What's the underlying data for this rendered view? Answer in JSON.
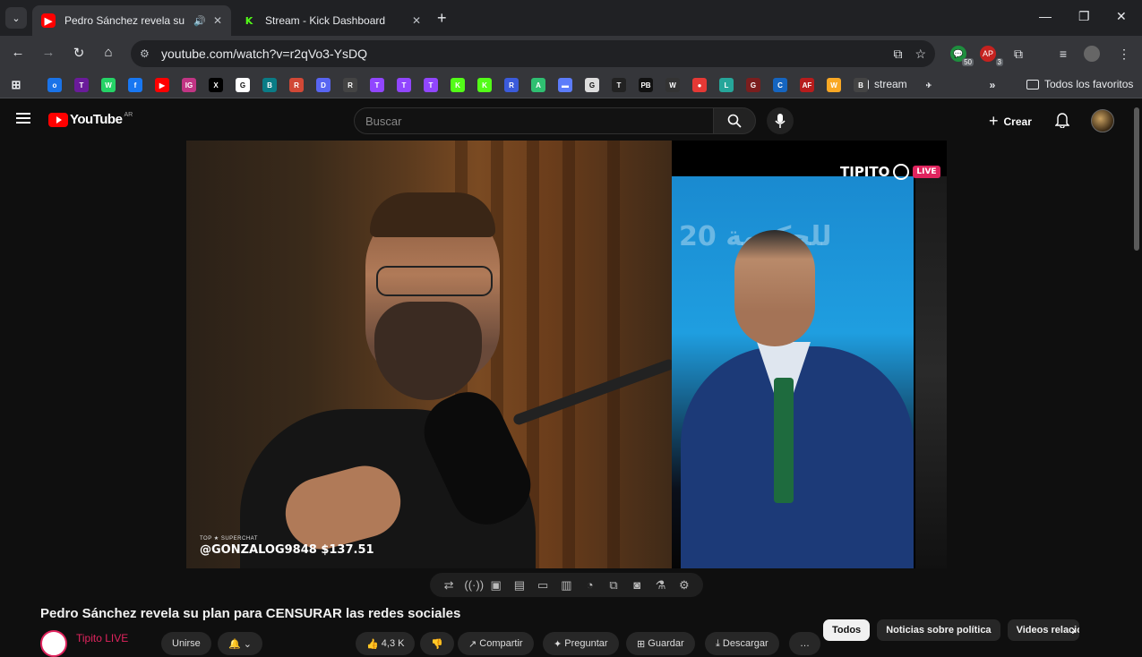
{
  "browser": {
    "tabs": [
      {
        "title": "Pedro Sánchez revela su pla",
        "favicon": "youtube-icon",
        "audio": true
      },
      {
        "title": "Stream - Kick Dashboard",
        "favicon": "kick-icon"
      }
    ],
    "url": "youtube.com/watch?v=r2qVo3-YsDQ",
    "extension_badges": {
      "chat": "50",
      "ap": "3"
    },
    "bookmarks_folder": "stream",
    "all_bookmarks": "Todos los favoritos",
    "bookmark_icons": [
      "o",
      "T",
      "W",
      "f",
      "▶",
      "IG",
      "X",
      "G",
      "B",
      "R",
      "D",
      "R",
      "T",
      "T",
      "T",
      "K",
      "K",
      "R",
      "A",
      "▬",
      "G",
      "T",
      "PB",
      "W",
      "●",
      "L",
      "G",
      "C",
      "AF",
      "W",
      "B"
    ]
  },
  "youtube": {
    "logo": "YouTube",
    "country": "AR",
    "search_placeholder": "Buscar",
    "create_label": "Crear"
  },
  "video": {
    "superchat_top": "TOP ★ SUPERCHAT",
    "superchat_line": "@GONZALOG9848 $137.51",
    "brand": "TIPITO",
    "brand_live": "LIVE",
    "stage_text": "للحكومة 20",
    "title": "Pedro Sánchez revela su plan para CENSURAR las redes sociales"
  },
  "channel": {
    "name": "Tipito LIVE",
    "join": "Unirse",
    "likes": "4,3 K",
    "share": "Compartir",
    "ask": "Preguntar",
    "save": "Guardar",
    "download": "Descargar"
  },
  "chips": [
    "Todos",
    "Noticias sobre política",
    "Videos relacion"
  ]
}
